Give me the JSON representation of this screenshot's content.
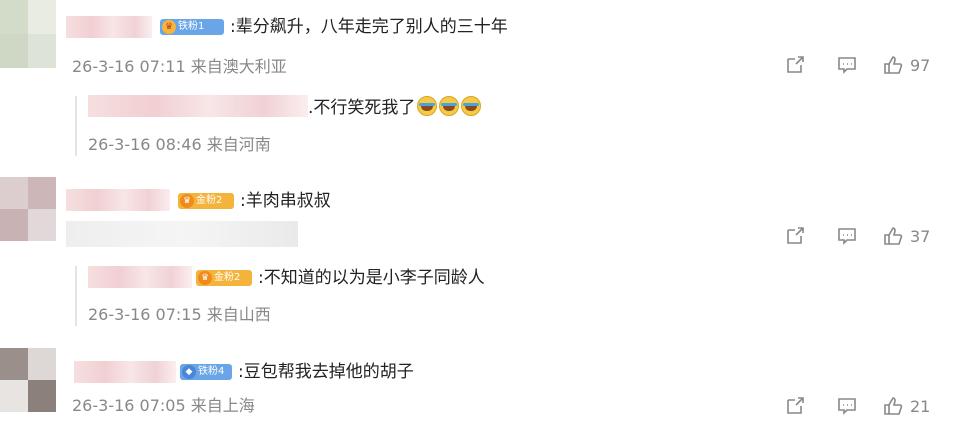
{
  "comments": [
    {
      "badge": "铁粉1",
      "text": ":辈分飙升，八年走完了别人的三十年",
      "meta": "26-3-16 07:11 来自澳大利亚",
      "forward_icon": "share-icon",
      "comment_icon": "comment-icon",
      "like_icon": "like-icon",
      "likes": "97",
      "reply": {
        "text": ".不行笑死我了",
        "emoji": [
          "laugh-cry-emoji",
          "laugh-cry-emoji",
          "laugh-cry-emoji"
        ],
        "meta": "26-3-16 08:46 来自河南"
      }
    },
    {
      "badge": "金粉2",
      "text": ":羊肉串叔叔",
      "meta": "",
      "likes": "37",
      "reply": {
        "badge": "金粉2",
        "text": ":不知道的以为是小李子同龄人",
        "meta": "26-3-16 07:15 来自山西"
      }
    },
    {
      "badge": "铁粉4",
      "text": ":豆包帮我去掉他的胡子",
      "meta": "26-3-16 07:05 来自上海",
      "likes": "21"
    }
  ]
}
